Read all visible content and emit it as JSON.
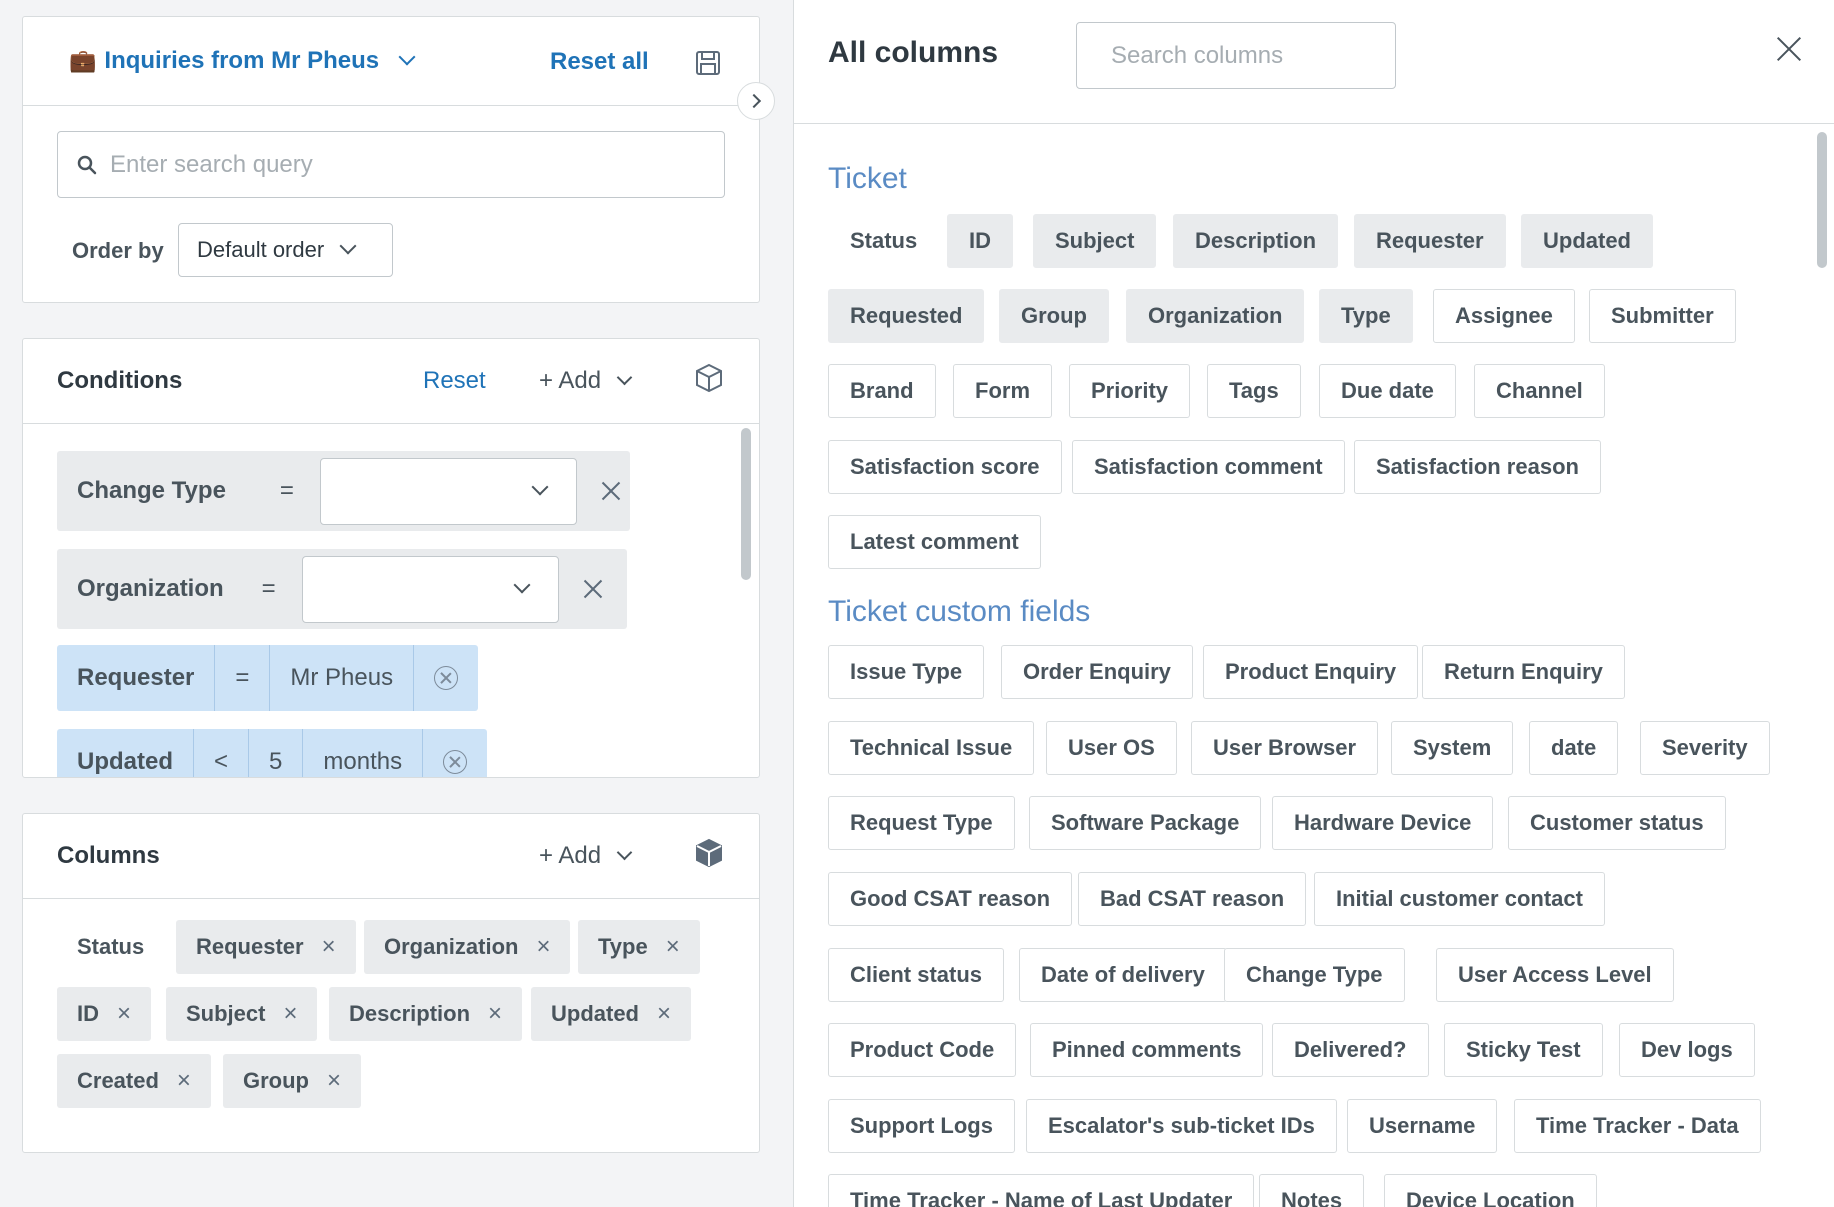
{
  "view": {
    "title": "Inquiries from Mr Pheus",
    "reset_all": "Reset all",
    "search_placeholder": "Enter search query",
    "order_label": "Order by",
    "order_value": "Default order"
  },
  "conditions": {
    "title": "Conditions",
    "reset": "Reset",
    "add": "+ Add",
    "rows": [
      {
        "field": "Change Type",
        "op": "=",
        "value": ""
      },
      {
        "field": "Organization",
        "op": "=",
        "value": ""
      }
    ],
    "chips": [
      {
        "field": "Requester",
        "op": "=",
        "value": "Mr Pheus"
      },
      {
        "field": "Updated",
        "op": "<",
        "value": "5",
        "unit": "months"
      }
    ]
  },
  "columns": {
    "title": "Columns",
    "add": "+ Add",
    "items": [
      "Status",
      "Requester",
      "Organization",
      "Type",
      "ID",
      "Subject",
      "Description",
      "Updated",
      "Created",
      "Group"
    ]
  },
  "drawer": {
    "title": "All columns",
    "search_placeholder": "Search columns",
    "groups": [
      {
        "name": "Ticket",
        "items": [
          "Status",
          "ID",
          "Subject",
          "Description",
          "Requester",
          "Updated",
          "Requested",
          "Group",
          "Organization",
          "Type",
          "Assignee",
          "Submitter",
          "Brand",
          "Form",
          "Priority",
          "Tags",
          "Due date",
          "Channel",
          "Satisfaction score",
          "Satisfaction comment",
          "Satisfaction reason",
          "Latest comment"
        ]
      },
      {
        "name": "Ticket custom fields",
        "items": [
          "Issue Type",
          "Order Enquiry",
          "Product Enquiry",
          "Return Enquiry",
          "Technical Issue",
          "User OS",
          "User Browser",
          "System",
          "date",
          "Severity",
          "Request Type",
          "Software Package",
          "Hardware Device",
          "Customer status",
          "Good CSAT reason",
          "Bad CSAT reason",
          "Initial customer contact",
          "Client status",
          "Date of delivery",
          "Change Type",
          "User Access Level",
          "Product Code",
          "Pinned comments",
          "Delivered?",
          "Sticky Test",
          "Dev logs",
          "Support Logs",
          "Escalator's sub-ticket IDs",
          "Username",
          "Time Tracker - Data",
          "Time Tracker - Name of Last Updater",
          "Notes",
          "Device Location"
        ]
      }
    ]
  }
}
